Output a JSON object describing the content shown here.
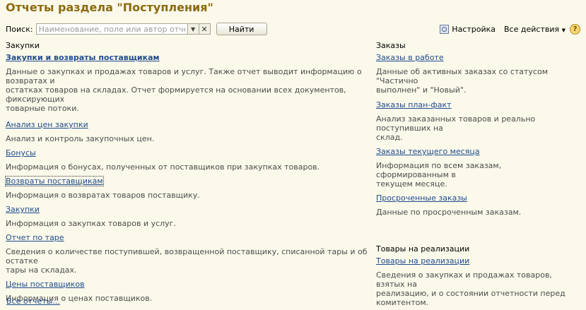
{
  "page": {
    "title": "Отчеты раздела \"Поступления\""
  },
  "search": {
    "label": "Поиск:",
    "placeholder": "Наименование, поле или автор отчета",
    "find_button": "Найти"
  },
  "toolbar": {
    "settings": "Настройка",
    "all_actions": "Все действия",
    "help": "?"
  },
  "left_group": {
    "title": "Закупки",
    "items": [
      {
        "link": "Закупки и возвраты поставщикам",
        "desc": [
          "Данные о закупках и продажах товаров и услуг. Также отчет выводит информацию о возвратах и",
          "остатках товаров на складах. Отчет формируется на основании всех документов, фиксирующих",
          "товарные потоки."
        ]
      },
      {
        "link": "Анализ цен закупки",
        "desc": [
          "Анализ и контроль закупочных цен."
        ]
      },
      {
        "link": "Бонусы",
        "desc": [
          "Информация о бонусах, полученных от поставщиков при закупках товаров."
        ]
      },
      {
        "link": "Возвраты поставщикам",
        "desc": [
          "Информация о возвратах товаров поставщику."
        ]
      },
      {
        "link": "Закупки",
        "desc": [
          "Информация о закупках товаров и услуг."
        ]
      },
      {
        "link": "Отчет по таре",
        "desc": [
          "Сведения о количестве поступившей, возвращенной поставщику, списанной тары и об остатке",
          "тары на складах."
        ]
      },
      {
        "link": "Цены поставщиков",
        "desc": [
          "Информация о ценах поставщиков."
        ]
      }
    ]
  },
  "right_group": {
    "title": "Заказы",
    "items": [
      {
        "link": "Заказы в работе",
        "desc": [
          "Данные об активных заказах со статусом \"Частично",
          "выполнен\" и \"Новый\"."
        ]
      },
      {
        "link": "Заказы план-факт",
        "desc": [
          "Анализ заказанных товаров и реально поступивших на",
          "склад."
        ]
      },
      {
        "link": "Заказы текущего месяца",
        "desc": [
          "Информация по всем заказам, сформированным в",
          "текущем месяце."
        ]
      },
      {
        "link": "Просроченные заказы",
        "desc": [
          "Данные по просроченным заказам."
        ]
      }
    ]
  },
  "consign_group": {
    "title": "Товары на реализации",
    "items": [
      {
        "link": "Товары на реализации",
        "desc": [
          "Сведения о закупках и продажах товаров, взятых на",
          "реализацию, и о состоянии отчетности перед",
          "комитентом."
        ]
      }
    ]
  },
  "footer": {
    "all_reports": "Все отчеты..."
  }
}
